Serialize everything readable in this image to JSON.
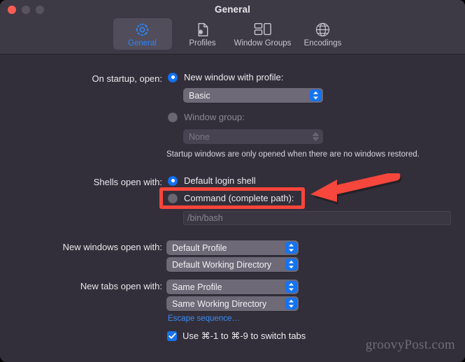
{
  "window": {
    "title": "General",
    "traffic_lights": [
      {
        "name": "close-button",
        "color": "#f95d52"
      },
      {
        "name": "minimize-button",
        "color": "#575360"
      },
      {
        "name": "maximize-button",
        "color": "#575360"
      }
    ]
  },
  "toolbar": {
    "tabs": [
      {
        "label": "General",
        "icon": "gear-icon",
        "selected": true
      },
      {
        "label": "Profiles",
        "icon": "document-gear-icon",
        "selected": false
      },
      {
        "label": "Window Groups",
        "icon": "window-groups-icon",
        "selected": false
      },
      {
        "label": "Encodings",
        "icon": "globe-icon",
        "selected": false
      }
    ]
  },
  "form": {
    "startup": {
      "label": "On startup, open:",
      "radio_new_window": {
        "text": "New window with profile:",
        "selected": true
      },
      "profile_select": {
        "value": "Basic",
        "enabled": true
      },
      "radio_window_group": {
        "text": "Window group:",
        "selected": false,
        "enabled": false
      },
      "window_group_select": {
        "value": "None",
        "enabled": false
      },
      "note": "Startup windows are only opened when there are no windows restored."
    },
    "shells": {
      "label": "Shells open with:",
      "radio_default": {
        "text": "Default login shell",
        "selected": true
      },
      "radio_command": {
        "text": "Command (complete path):",
        "selected": false
      },
      "command_field": {
        "value": "/bin/bash",
        "enabled": false
      }
    },
    "new_windows": {
      "label": "New windows open with:",
      "profile_select": {
        "value": "Default Profile"
      },
      "directory_select": {
        "value": "Default Working Directory"
      }
    },
    "new_tabs": {
      "label": "New tabs open with:",
      "profile_select": {
        "value": "Same Profile"
      },
      "directory_select": {
        "value": "Same Working Directory"
      }
    },
    "escape_sequence_link": "Escape sequence…",
    "switch_tabs_checkbox": {
      "label": "Use ⌘-1 to ⌘-9 to switch tabs",
      "checked": true
    }
  },
  "annotation": {
    "highlight_target": "Command (complete path):",
    "color": "#f7463c"
  },
  "watermark": "groovyPost.com"
}
